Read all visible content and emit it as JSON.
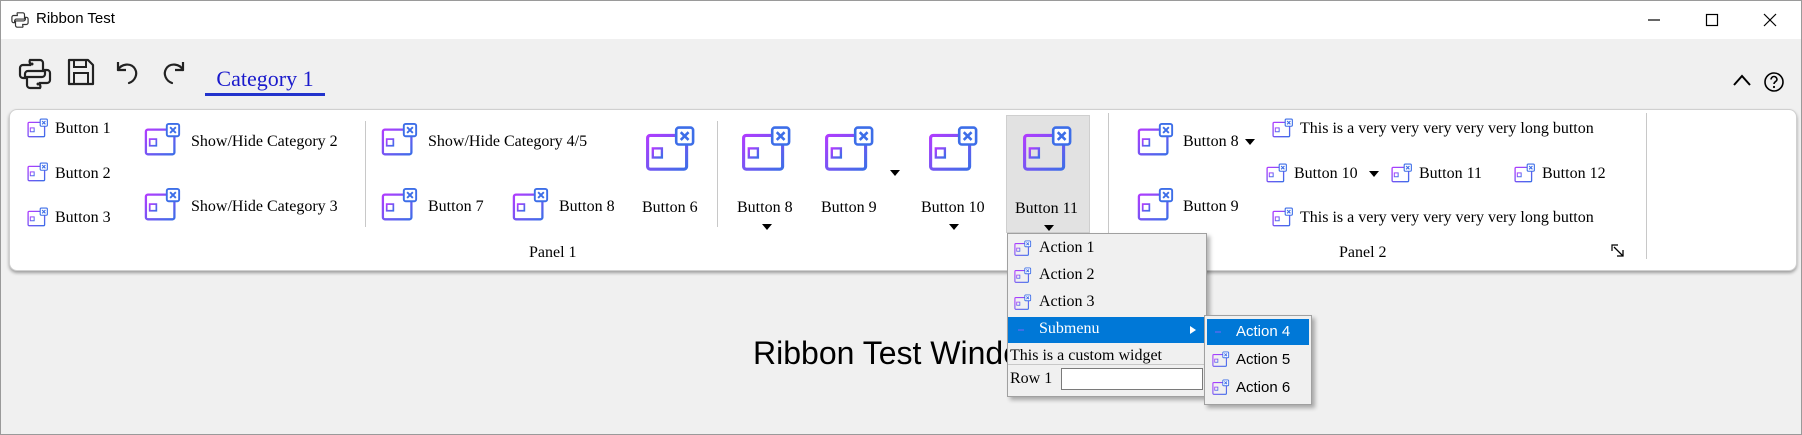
{
  "window": {
    "title": "Ribbon Test"
  },
  "category_tab": "Category 1",
  "panel1": {
    "title": "Panel 1",
    "small_col1": [
      "Button 1",
      "Button 2",
      "Button 3"
    ],
    "show_hide_2": "Show/Hide Category 2",
    "show_hide_3": "Show/Hide Category 3",
    "show_hide_45": "Show/Hide Category 4/5",
    "btn7": "Button 7",
    "btn8_small": "Button 8",
    "btn6": "Button 6",
    "btn8": "Button 8",
    "btn9": "Button 9",
    "btn10": "Button 10",
    "btn11": "Button 11"
  },
  "panel2": {
    "title": "Panel 2",
    "btn8": "Button 8",
    "btn9": "Button 9",
    "long1": "This is a very very very very very long button",
    "btn10": "Button 10",
    "btn11": "Button 11",
    "btn12": "Button 12",
    "long2": "This is a very very very very very long button"
  },
  "content": {
    "title": "Ribbon Test Window"
  },
  "menu": {
    "items": [
      "Action 1",
      "Action 2",
      "Action 3"
    ],
    "submenu_label": "Submenu",
    "custom_widget": "This is a custom widget",
    "row_label": "Row 1",
    "row_value": ""
  },
  "submenu": {
    "items": [
      "Action 4",
      "Action 5",
      "Action 6"
    ]
  },
  "colors": {
    "accent": "#0078d7",
    "icon_gradient_start": "#a233ff",
    "icon_gradient_end": "#3f6fe6"
  }
}
